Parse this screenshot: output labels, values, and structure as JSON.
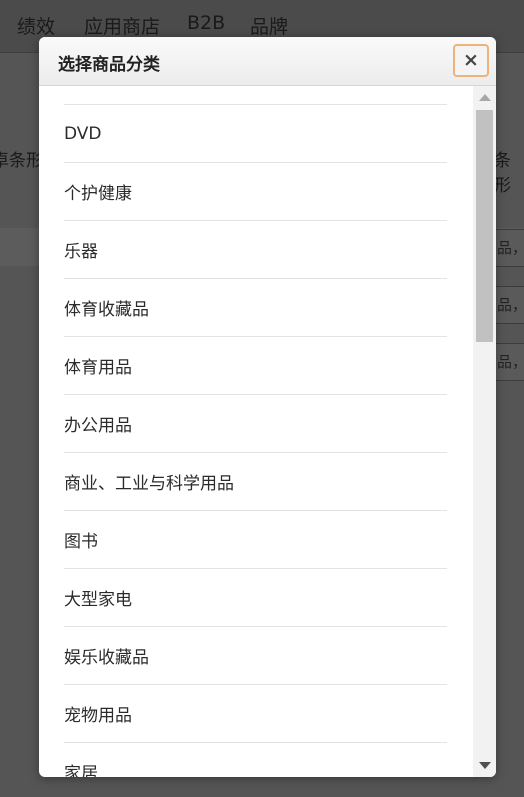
{
  "background": {
    "nav_items": [
      "绩效",
      "应用商店",
      "B2B",
      "品牌"
    ],
    "left_fragment": "卓条形",
    "right_fragment": "条形",
    "input_fragment": "品，"
  },
  "dialog": {
    "title": "选择商品分类",
    "close_label": "×",
    "categories": [
      "DVD",
      "个护健康",
      "乐器",
      "体育收藏品",
      "体育用品",
      "办公用品",
      "商业、工业与科学用品",
      "图书",
      "大型家电",
      "娱乐收藏品",
      "宠物用品",
      "家居"
    ]
  },
  "colors": {
    "overlay": "#4a4a4a",
    "close_border": "#f0b27a",
    "scroll_thumb": "#c1c1c1"
  }
}
